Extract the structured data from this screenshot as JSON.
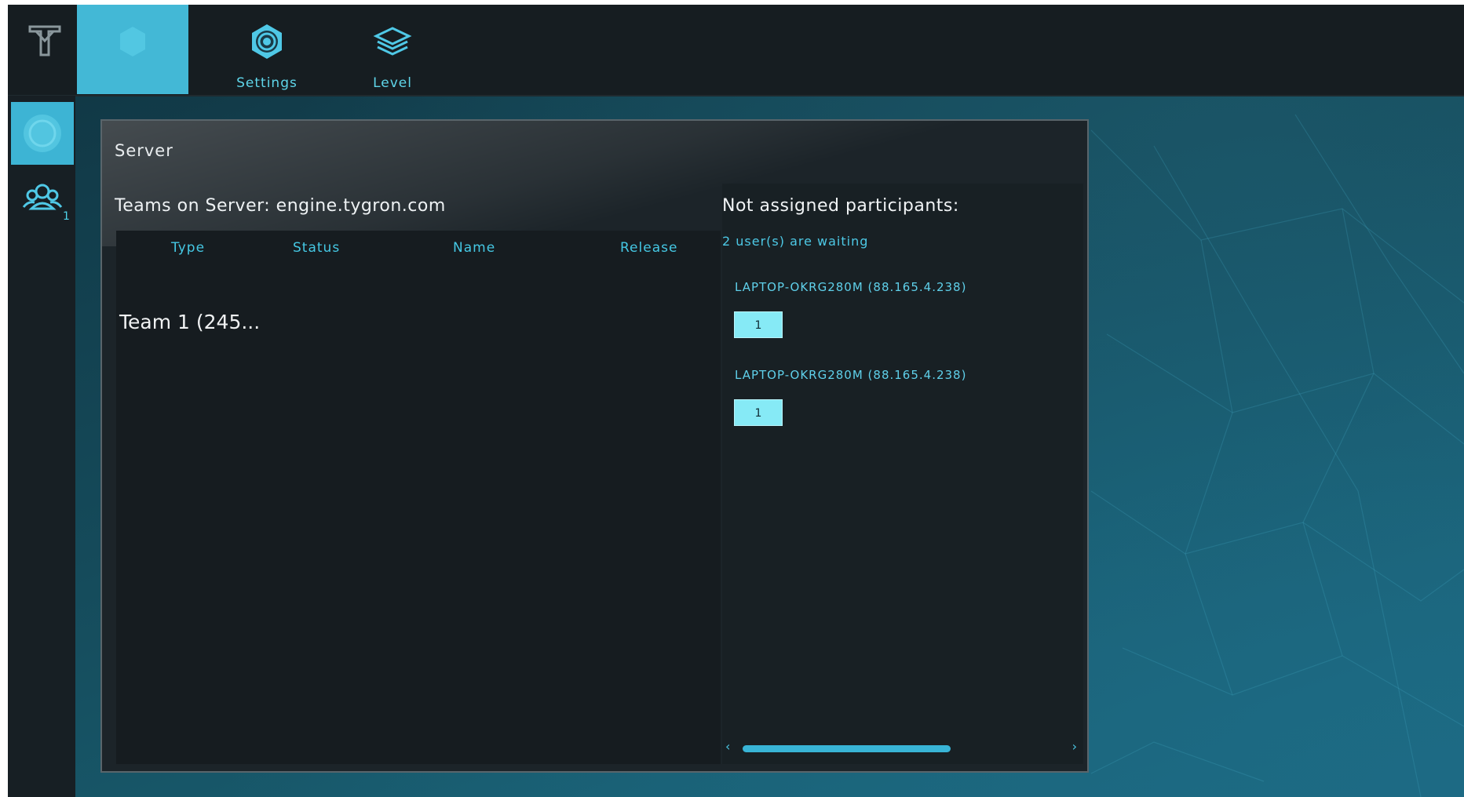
{
  "topbar": {
    "tabs": [
      {
        "label": "",
        "icon": "gear-icon"
      },
      {
        "label": "Settings",
        "icon": "target-icon"
      },
      {
        "label": "Level",
        "icon": "layers-icon"
      }
    ]
  },
  "sidebar": {
    "user_count": "1"
  },
  "panel": {
    "title": "Server",
    "teams_heading": "Teams on Server: engine.tygron.com",
    "columns": [
      "Type",
      "Status",
      "Name",
      "Release"
    ],
    "teams": [
      "Team 1 (245..."
    ],
    "unassigned": {
      "title": "Not assigned participants:",
      "count_text": "2 user(s) are waiting",
      "users": [
        {
          "name": "LAPTOP-OKRG280M (88.165.4.238)",
          "team_button": "1"
        },
        {
          "name": "LAPTOP-OKRG280M (88.165.4.238)",
          "team_button": "1"
        }
      ]
    }
  },
  "colors": {
    "accent": "#43b8d6",
    "text_accent": "#45c8e4",
    "panel_bg": "#1c2429",
    "topbar_bg": "#161d21"
  }
}
